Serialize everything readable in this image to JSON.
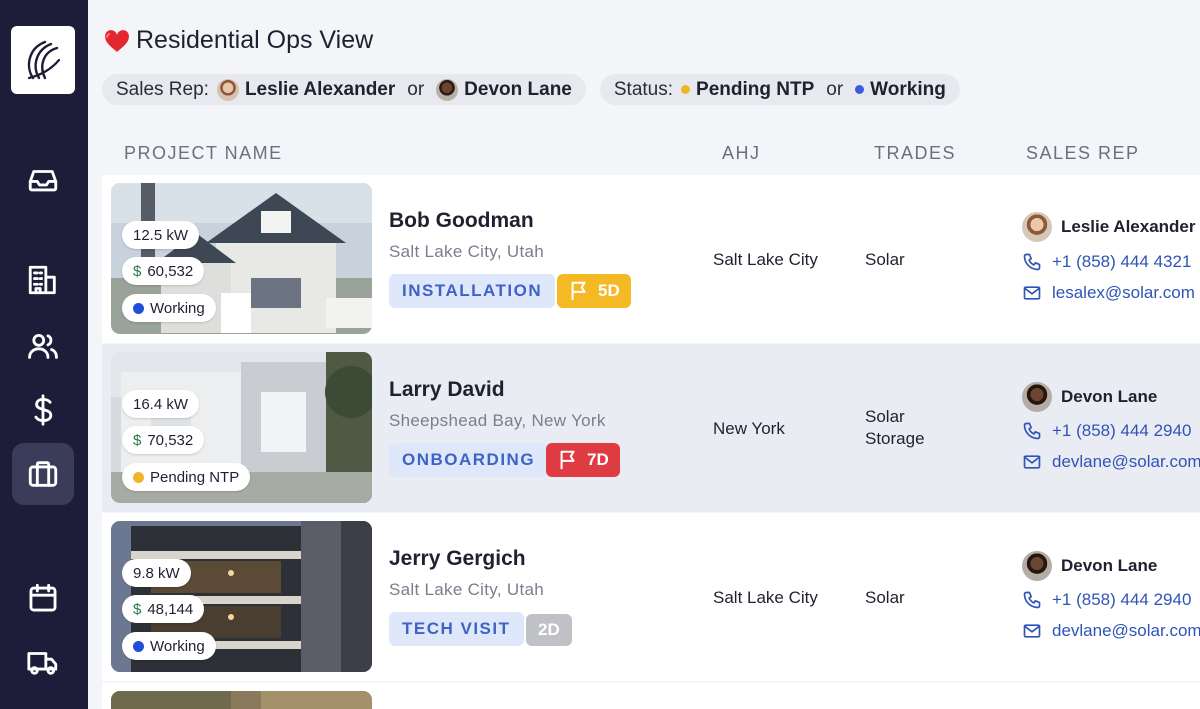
{
  "page": {
    "title": "Residential Ops View"
  },
  "filters": {
    "sales_rep": {
      "label": "Sales Rep:",
      "values": [
        "Leslie Alexander",
        "Devon Lane"
      ],
      "joiner": "or"
    },
    "status": {
      "label": "Status:",
      "values": [
        "Pending NTP",
        "Working"
      ],
      "joiner": "or",
      "colors": [
        "#f0b429",
        "#3b5bdb"
      ]
    }
  },
  "columns": [
    "PROJECT NAME",
    "AHJ",
    "TRADES",
    "SALES REP"
  ],
  "rows": [
    {
      "kw": "12.5 kW",
      "price_symbol": "$",
      "price": "60,532",
      "status": "Working",
      "status_color": "#1f4fd8",
      "name": "Bob Goodman",
      "location": "Salt Lake City, Utah",
      "stage": "INSTALLATION",
      "flag": "5D",
      "flag_color": "#f6b926",
      "ahj": "Salt Lake City",
      "trades": [
        "Solar"
      ],
      "rep": {
        "name": "Leslie Alexander",
        "phone": "+1 (858) 444 4321",
        "email": "lesalex@solar.com"
      }
    },
    {
      "kw": "16.4 kW",
      "price_symbol": "$",
      "price": "70,532",
      "status": "Pending NTP",
      "status_color": "#f0b429",
      "name": "Larry David",
      "location": "Sheepshead Bay, New York",
      "stage": "ONBOARDING",
      "flag": "7D",
      "flag_color": "#de3b43",
      "ahj": "New York",
      "trades": [
        "Solar",
        "Storage"
      ],
      "rep": {
        "name": "Devon Lane",
        "phone": "+1 (858) 444 2940",
        "email": "devlane@solar.com"
      }
    },
    {
      "kw": "9.8 kW",
      "price_symbol": "$",
      "price": "48,144",
      "status": "Working",
      "status_color": "#1f4fd8",
      "name": "Jerry Gergich",
      "location": "Salt Lake City, Utah",
      "stage": "TECH VISIT",
      "flag": "2D",
      "flag_color": "#bfc1c6",
      "ahj": "Salt Lake City",
      "trades": [
        "Solar"
      ],
      "rep": {
        "name": "Devon Lane",
        "phone": "+1 (858) 444 2940",
        "email": "devlane@solar.com"
      }
    }
  ],
  "icons": {
    "logo": "brand-logo-icon",
    "inbox": "inbox-icon",
    "buildings": "buildings-icon",
    "users": "users-icon",
    "dollar": "dollar-icon",
    "briefcase": "briefcase-icon",
    "calendar": "calendar-icon",
    "truck": "truck-icon",
    "phone": "phone-icon",
    "mail": "mail-icon",
    "flag": "flag-icon",
    "heart": "heart-icon"
  }
}
